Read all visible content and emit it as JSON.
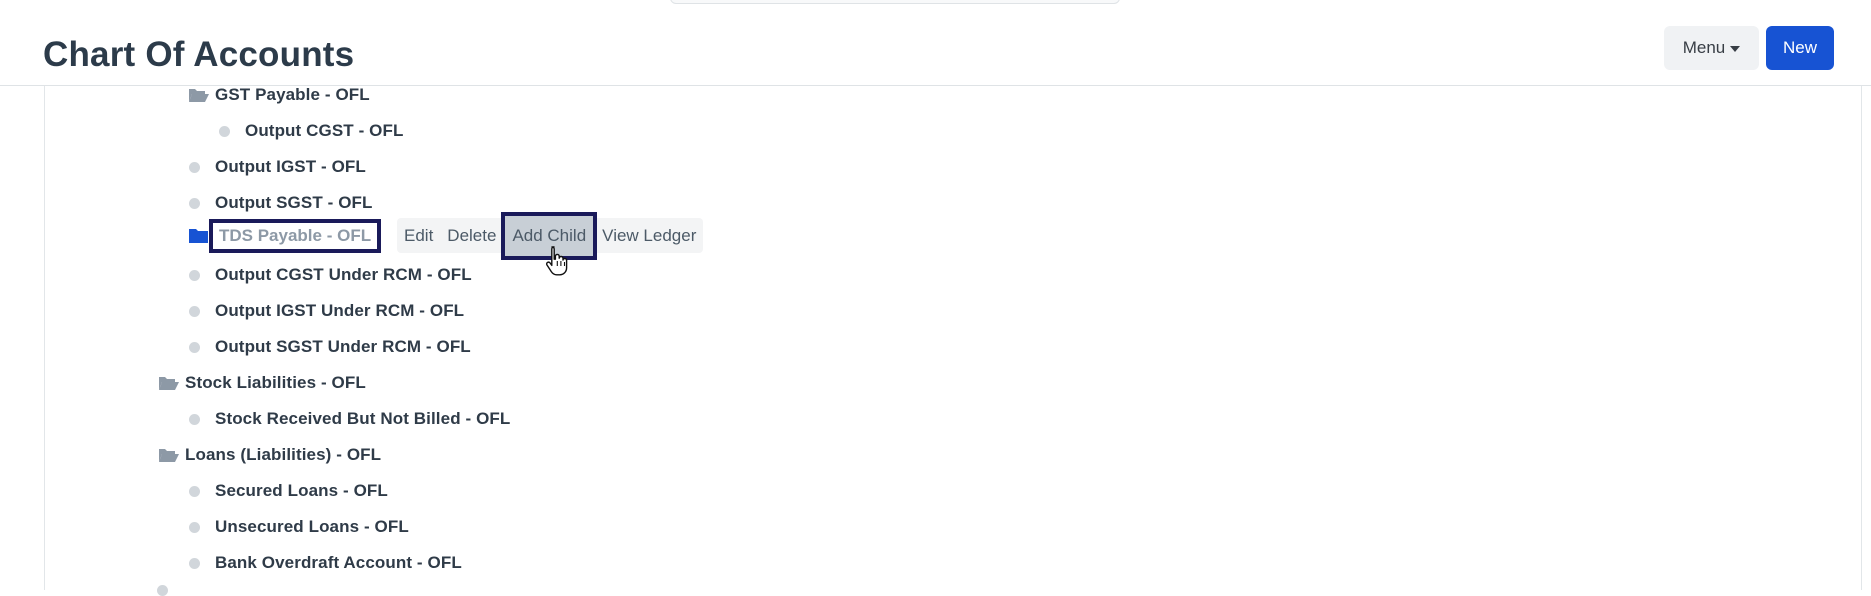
{
  "header": {
    "title": "Chart Of Accounts",
    "menu_label": "Menu",
    "new_label": "New"
  },
  "colors": {
    "primary": "#1753d3",
    "title": "#2c3b4a",
    "selected_text": "#8d99a6",
    "highlight_border": "#1a1a5a"
  },
  "tree": {
    "gst_payable": "GST Payable - OFL",
    "output_cgst": "Output CGST - OFL",
    "output_igst": "Output IGST - OFL",
    "output_sgst": "Output SGST - OFL",
    "tds_payable": "TDS Payable - OFL",
    "output_cgst_rcm": "Output CGST Under RCM - OFL",
    "output_igst_rcm": "Output IGST Under RCM - OFL",
    "output_sgst_rcm": "Output SGST Under RCM - OFL",
    "stock_liabilities": "Stock Liabilities - OFL",
    "stock_received": "Stock Received But Not Billed - OFL",
    "loans": "Loans (Liabilities) - OFL",
    "secured_loans": "Secured Loans - OFL",
    "unsecured_loans": "Unsecured Loans - OFL",
    "bank_overdraft": "Bank Overdraft Account - OFL"
  },
  "actions": {
    "edit": "Edit",
    "delete": "Delete",
    "add_child": "Add Child",
    "view_ledger": "View Ledger"
  },
  "icons": {
    "folder_open": "folder-open-icon",
    "folder_closed": "folder-icon",
    "leaf": "leaf-dot-icon",
    "cursor": "hand-pointer-icon"
  }
}
